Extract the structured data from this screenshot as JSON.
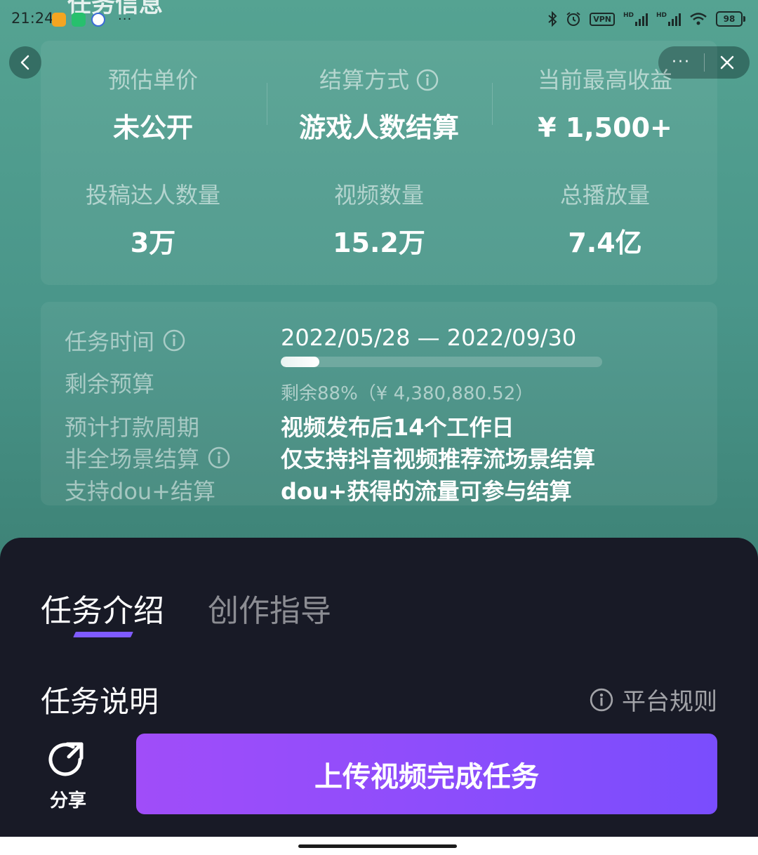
{
  "status_bar": {
    "time": "21:24",
    "more": "···",
    "vpn": "VPN",
    "hd1": "HD",
    "hd2": "HD",
    "battery": "98"
  },
  "partial_heading": "任务信息",
  "capsule": {
    "more": "···"
  },
  "stats": [
    {
      "label": "预估单价",
      "value": "未公开"
    },
    {
      "label": "结算方式",
      "value": "游戏人数结算"
    },
    {
      "label": "当前最高收益",
      "value": "¥ 1,500+"
    },
    {
      "label": "投稿达人数量",
      "value": "3万"
    },
    {
      "label": "视频数量",
      "value": "15.2万"
    },
    {
      "label": "总播放量",
      "value": "7.4亿"
    }
  ],
  "details": {
    "task_time_label": "任务时间",
    "task_time_value": "2022/05/28 — 2022/09/30",
    "budget_label": "剩余预算",
    "budget_remaining_fraction": 0.12,
    "budget_remaining_text": "剩余88%（¥ 4,380,880.52）",
    "payment_label": "预计打款周期",
    "payment_value": "视频发布后14个工作日",
    "scene_label": "非全场景结算",
    "scene_value": "仅支持抖音视频推荐流场景结算",
    "dou_label": "支持dou+结算",
    "dou_value": "dou+获得的流量可参与结算"
  },
  "tabs": [
    {
      "label": "任务介绍",
      "active": true
    },
    {
      "label": "创作指导",
      "active": false
    }
  ],
  "section": {
    "title": "任务说明",
    "rules_link": "平台规则"
  },
  "share": {
    "label": "分享"
  },
  "cta": {
    "label": "上传视频完成任务"
  },
  "colors": {
    "accent": "#7f5bff",
    "cta_start": "#a04df9",
    "cta_end": "#7a4dfd",
    "sheet_bg": "#181a26"
  }
}
